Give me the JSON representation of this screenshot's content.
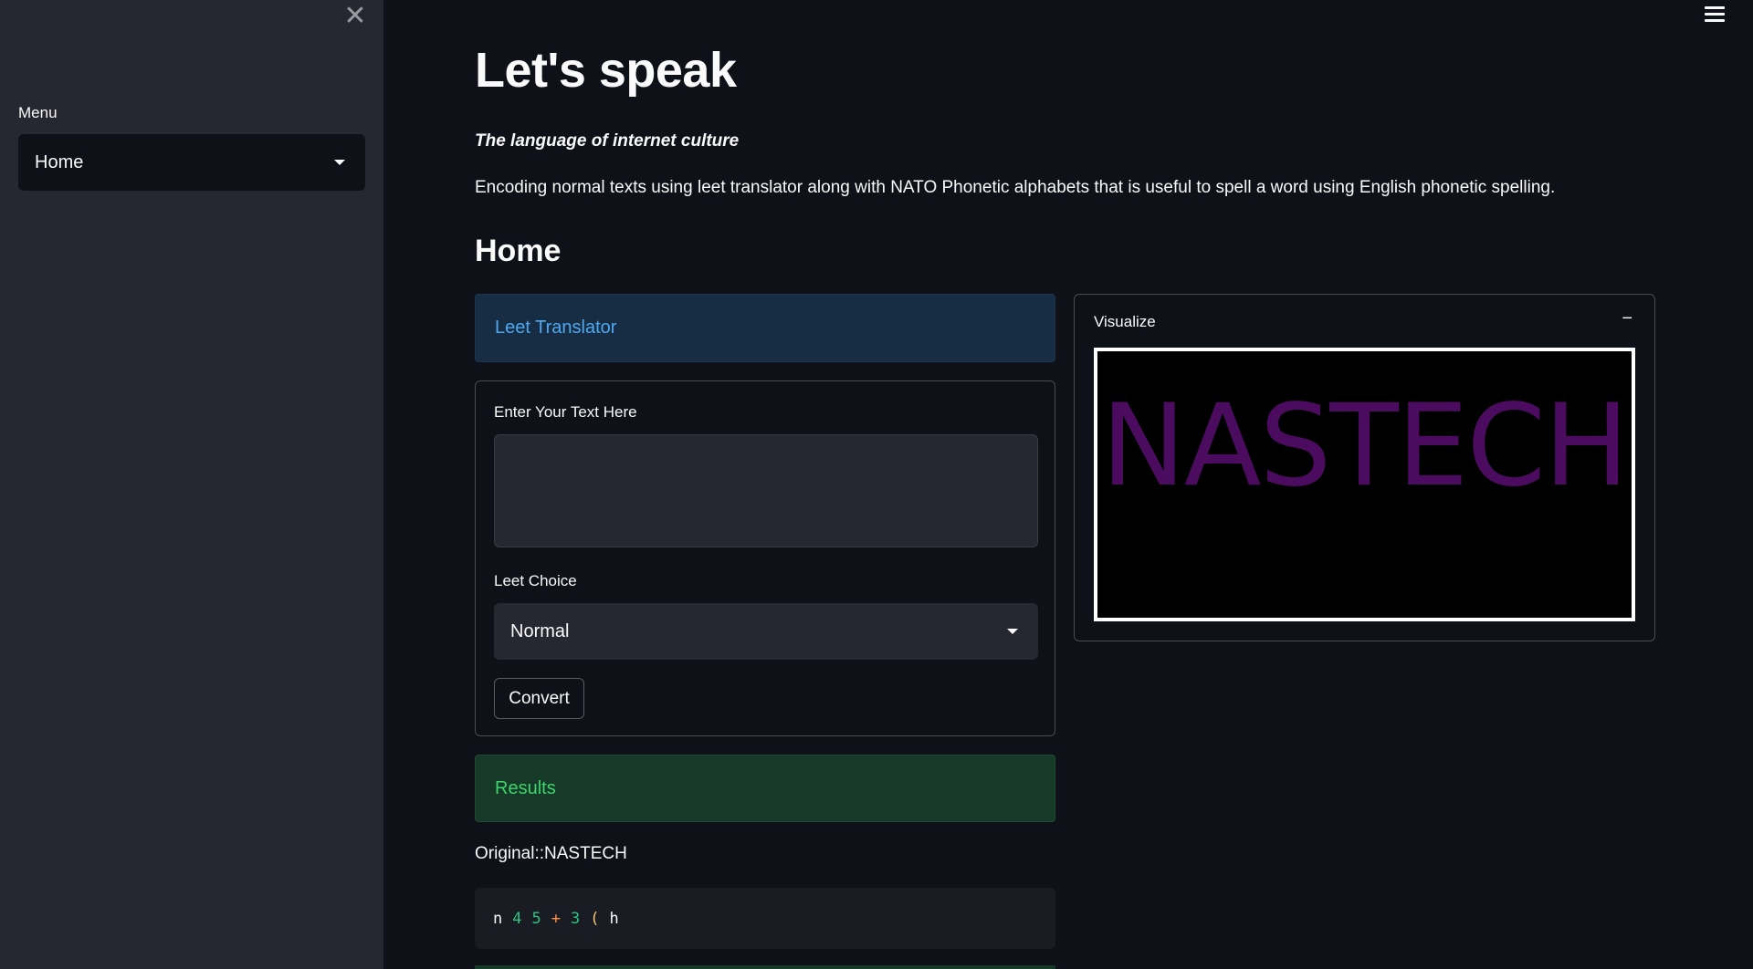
{
  "sidebar": {
    "menu_label": "Menu",
    "selected": "Home"
  },
  "header": {
    "title": "Let's speak",
    "subtitle": "The language of internet culture",
    "description": "Encoding normal texts using leet translator along with NATO Phonetic alphabets that is useful to spell a word using English phonetic spelling."
  },
  "section": {
    "heading": "Home"
  },
  "info": {
    "text": "Leet Translator"
  },
  "form": {
    "text_label": "Enter Your Text Here",
    "text_value": "",
    "choice_label": "Leet Choice",
    "choice_value": "Normal",
    "convert_label": "Convert"
  },
  "results": {
    "header": "Results",
    "original": "Original::NASTECH",
    "code_tokens": [
      "n",
      "4",
      "5",
      "+",
      "3",
      "(",
      "h"
    ]
  },
  "visualize": {
    "title": "Visualize",
    "collapse_symbol": "−",
    "image_word": "NASTECH"
  },
  "colors": {
    "background": "#0e1117",
    "sidebar": "#262730",
    "info_text": "#4fa8f0",
    "success_text": "#3dd56d",
    "viz_word": "#4b0b5e"
  },
  "icons": {
    "close": "close-icon",
    "menu": "hamburger-icon",
    "dropdown": "chevron-down-icon",
    "grammarly": "grammarly-icon"
  }
}
